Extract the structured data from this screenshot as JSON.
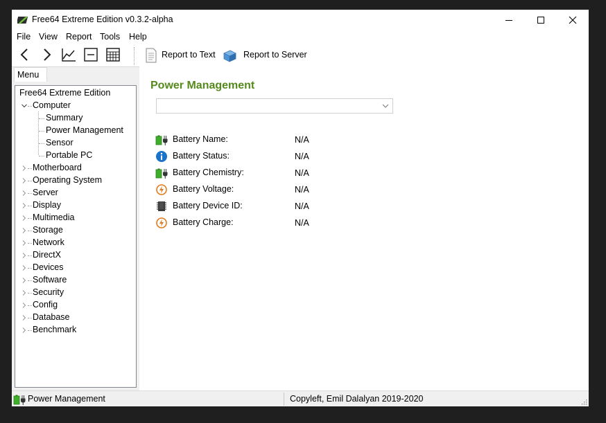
{
  "window": {
    "title": "Free64 Extreme Edition v0.3.2-alpha"
  },
  "menubar": {
    "items": [
      "File",
      "View",
      "Report",
      "Tools",
      "Help"
    ]
  },
  "toolbar": {
    "report_text_label": "Report to Text",
    "report_server_label": "Report to Server",
    "icons": [
      "back-icon",
      "forward-icon",
      "chart-icon",
      "form-icon",
      "calculator-icon",
      "document-icon",
      "server-icon"
    ]
  },
  "left_tab": {
    "label": "Menu"
  },
  "tree": {
    "root": "Free64 Extreme Edition",
    "computer": "Computer",
    "computer_children": [
      "Summary",
      "Power Management",
      "Sensor",
      "Portable PC"
    ],
    "categories": [
      "Motherboard",
      "Operating System",
      "Server",
      "Display",
      "Multimedia",
      "Storage",
      "Network",
      "DirectX",
      "Devices",
      "Software",
      "Security",
      "Config",
      "Database",
      "Benchmark"
    ]
  },
  "content": {
    "title": "Power Management",
    "combo_value": "",
    "properties": [
      {
        "icon": "battery-icon",
        "name": "Battery Name:",
        "value": "N/A"
      },
      {
        "icon": "info-icon",
        "name": "Battery Status:",
        "value": "N/A"
      },
      {
        "icon": "battery-icon",
        "name": "Battery Chemistry:",
        "value": "N/A"
      },
      {
        "icon": "power-icon",
        "name": "Battery Voltage:",
        "value": "N/A"
      },
      {
        "icon": "chip-icon",
        "name": "Battery Device ID:",
        "value": "N/A"
      },
      {
        "icon": "power-icon",
        "name": "Battery Charge:",
        "value": "N/A"
      }
    ]
  },
  "statusbar": {
    "left": "Power Management",
    "right": "Copyleft, Emil Dalalyan 2019-2020"
  },
  "colors": {
    "accent_green": "#548a1c",
    "info_blue": "#1a73c9",
    "power_orange": "#e07a1a"
  }
}
